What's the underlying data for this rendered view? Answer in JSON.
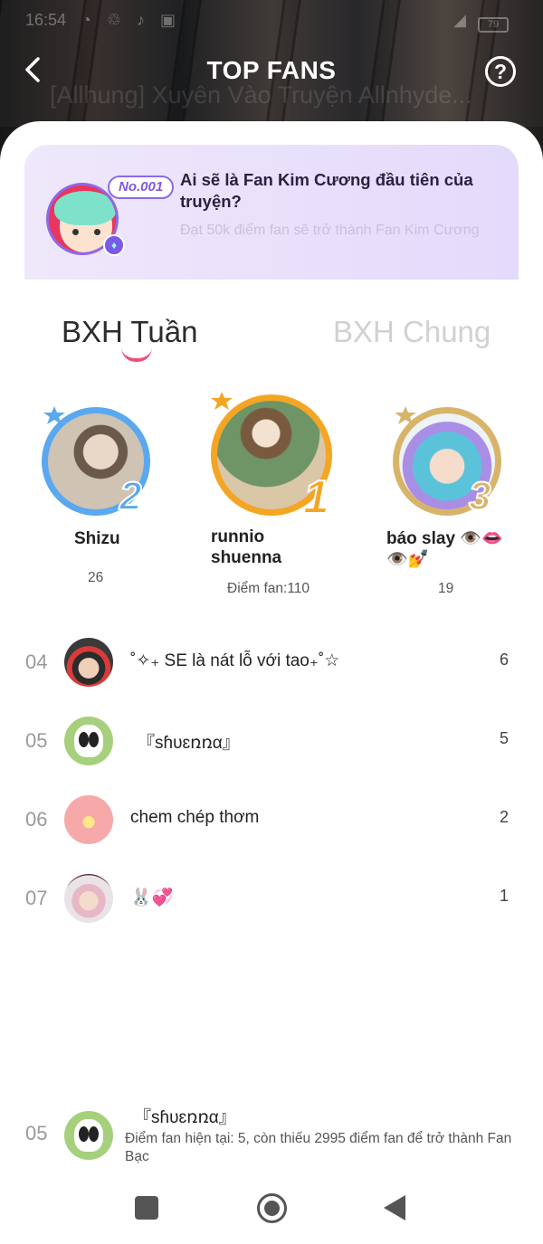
{
  "status_bar": {
    "time": "16:54",
    "icons": "◔ ♲ ♪ ▣",
    "signal": "◢",
    "battery": "79"
  },
  "background_title": "[Allhung] Xuyên Vào Truyện Allnhyde...",
  "header": {
    "title": "TOP FANS",
    "back_icon": "chevron-left-icon",
    "help_label": "?"
  },
  "banner": {
    "badge": "No.001",
    "title": "Ai sẽ là Fan Kim Cương đầu tiên của truyện?",
    "subtitle": "Đạt 50k điểm fan sẽ trở thành Fan Kim Cương"
  },
  "tabs": [
    {
      "label": "BXH Tuần",
      "active": true
    },
    {
      "label": "BXH Chung",
      "active": false
    }
  ],
  "podium": [
    {
      "rank": "2",
      "name": "Shizu",
      "score": "26",
      "ring_color": "#5aa8ef"
    },
    {
      "rank": "1",
      "name": "runnio shuenna",
      "score": "Điểm fan:110",
      "ring_color": "#f5a524"
    },
    {
      "rank": "3",
      "name": "báo slay 👁️👄👁️💅",
      "score": "19",
      "ring_color": "#d8b46a"
    }
  ],
  "ranking": [
    {
      "rank": "04",
      "name": "˚✧₊ SE là nát lỗ với tao₊˚☆",
      "score": "6"
    },
    {
      "rank": "05",
      "name": "『sɦυɛռռα』",
      "score": "5"
    },
    {
      "rank": "06",
      "name": "chem chép thơm",
      "score": "2"
    },
    {
      "rank": "07",
      "name": "🐰💞",
      "score": "1"
    }
  ],
  "my_rank": {
    "rank": "05",
    "name": "『sɦυɛռռα』",
    "info": "Điểm fan hiện tại: 5, còn thiếu 2995 điểm fan để trở thành Fan Bạc"
  },
  "colors": {
    "accent": "#ee4d7a",
    "banner_bg": "#e9e1fb",
    "badge": "#7c5ae0"
  }
}
